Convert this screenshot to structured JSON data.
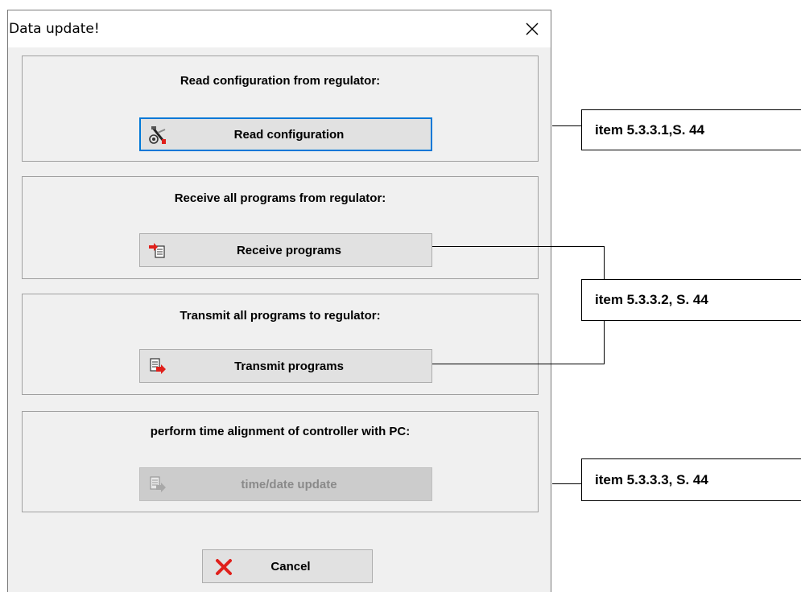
{
  "dialog": {
    "title": "Data update!",
    "close_icon": "close-icon"
  },
  "groups": [
    {
      "label": "Read configuration from regulator:",
      "button_label": "Read configuration",
      "icon": "tools-icon",
      "enabled": true,
      "focused": true
    },
    {
      "label": "Receive all programs from regulator:",
      "button_label": "Receive programs",
      "icon": "receive-programs-icon",
      "enabled": true
    },
    {
      "label": "Transmit all programs to regulator:",
      "button_label": "Transmit programs",
      "icon": "transmit-programs-icon",
      "enabled": true
    },
    {
      "label": "perform time alignment of controller with PC:",
      "button_label": "time/date update",
      "icon": "time-update-icon",
      "enabled": false
    }
  ],
  "cancel": {
    "label": "Cancel",
    "icon": "red-x-icon"
  },
  "callouts": [
    "item 5.3.3.1,S. 44",
    "item 5.3.3.2, S. 44",
    "item 5.3.3.3, S. 44"
  ],
  "colors": {
    "focus_border": "#0078d7",
    "dialog_bg": "#f0f0f0",
    "button_bg": "#e1e1e1",
    "icon_red": "#e0201b"
  }
}
